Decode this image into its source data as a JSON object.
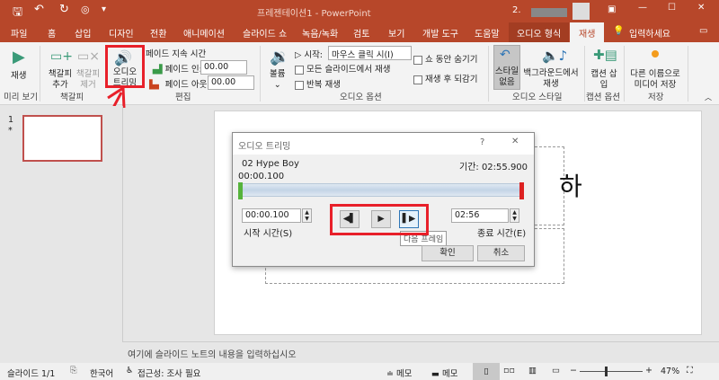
{
  "titlebar": {
    "title": "프레젠테이션1 - PowerPoint",
    "user_initial": "2."
  },
  "tabs": [
    "파일",
    "홈",
    "삽입",
    "디자인",
    "전환",
    "애니메이션",
    "슬라이드 쇼",
    "녹음/녹화",
    "검토",
    "보기",
    "개발 도구",
    "도움말",
    "오디오 형식",
    "재생",
    "입력하세요"
  ],
  "ribbon": {
    "play": "재생",
    "group_preview": "미리 보기",
    "add_bookmark": "책갈피 추가",
    "remove_bookmark": "책갈피 제거",
    "group_bookmark": "책갈피",
    "trim_audio": "오디오 트리밍",
    "fade_duration": "페이드 지속 시간",
    "fade_in_label": "페이드 인:",
    "fade_in": "00.00",
    "fade_out_label": "페이드 아웃:",
    "fade_out": "00.00",
    "group_edit": "편집",
    "volume": "볼륨",
    "start_label": "시작:",
    "start_value": "마우스 클릭 시(I)",
    "play_across": "모든 슬라이드에서 재생",
    "loop": "반복 재생",
    "hide_during_show": "쇼 동안 숨기기",
    "rewind": "재생 후 되감기",
    "group_audio_options": "오디오 옵션",
    "no_style": "스타일 없음",
    "play_background": "백그라운드에서 재생",
    "group_audio_styles": "오디오 스타일",
    "insert_caption": "캡션 삽입",
    "group_caption": "캡션 옵션",
    "save_media_as": "다른 이름으로 미디어 저장",
    "group_save": "저장"
  },
  "thumbs": {
    "number": "1",
    "star": "*"
  },
  "slide": {
    "title_fragment": "하"
  },
  "dialog": {
    "title": "오디오 트리밍",
    "help": "?",
    "close": "✕",
    "track": "02 Hype Boy",
    "duration": "기간: 02:55.900",
    "position": "00:00.100",
    "start_time": "00:00.100",
    "start_label": "시작 시간(S)",
    "end_time": "02:56",
    "end_label": "종료 시간(E)",
    "tooltip": "다음 프레임",
    "ok": "확인",
    "cancel": "취소"
  },
  "notes": {
    "placeholder": "여기에 슬라이드 노트의 내용을 입력하십시오"
  },
  "status": {
    "slide": "슬라이드 1/1",
    "language": "한국어",
    "accessibility": "접근성: 조사 필요",
    "notes": "메모",
    "comments": "메모",
    "zoom": "47%"
  }
}
